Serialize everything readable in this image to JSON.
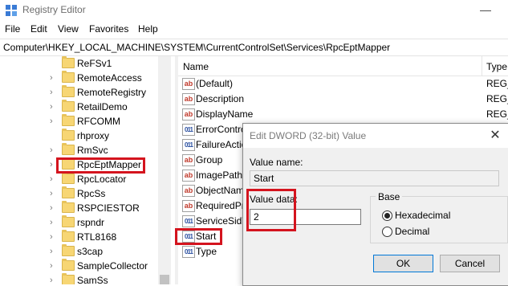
{
  "window": {
    "title": "Registry Editor",
    "minimize_glyph": "—"
  },
  "menu": [
    "File",
    "Edit",
    "View",
    "Favorites",
    "Help"
  ],
  "address": "Computer\\HKEY_LOCAL_MACHINE\\SYSTEM\\CurrentControlSet\\Services\\RpcEptMapper",
  "tree": {
    "items": [
      {
        "label": "ReFSv1",
        "has_children": false
      },
      {
        "label": "RemoteAccess",
        "has_children": true
      },
      {
        "label": "RemoteRegistry",
        "has_children": true
      },
      {
        "label": "RetailDemo",
        "has_children": true
      },
      {
        "label": "RFCOMM",
        "has_children": true
      },
      {
        "label": "rhproxy",
        "has_children": false
      },
      {
        "label": "RmSvc",
        "has_children": true
      },
      {
        "label": "RpcEptMapper",
        "has_children": true,
        "selected": true
      },
      {
        "label": "RpcLocator",
        "has_children": true
      },
      {
        "label": "RpcSs",
        "has_children": true
      },
      {
        "label": "RSPCIESTOR",
        "has_children": true
      },
      {
        "label": "rspndr",
        "has_children": true
      },
      {
        "label": "RTL8168",
        "has_children": true
      },
      {
        "label": "s3cap",
        "has_children": true
      },
      {
        "label": "SampleCollector",
        "has_children": true
      },
      {
        "label": "SamSs",
        "has_children": true
      }
    ]
  },
  "list": {
    "columns": {
      "name": "Name",
      "type": "Type"
    },
    "rows": [
      {
        "name": "(Default)",
        "type": "REG_",
        "kind": "string"
      },
      {
        "name": "Description",
        "type": "REG_",
        "kind": "string"
      },
      {
        "name": "DisplayName",
        "type": "REG_",
        "kind": "string"
      },
      {
        "name": "ErrorControl",
        "type": "",
        "kind": "dword"
      },
      {
        "name": "FailureActions",
        "type": "",
        "kind": "dword"
      },
      {
        "name": "Group",
        "type": "",
        "kind": "string"
      },
      {
        "name": "ImagePath",
        "type": "",
        "kind": "string"
      },
      {
        "name": "ObjectName",
        "type": "",
        "kind": "string"
      },
      {
        "name": "RequiredPrivileges",
        "type": "",
        "kind": "string"
      },
      {
        "name": "ServiceSidType",
        "type": "",
        "kind": "dword"
      },
      {
        "name": "Start",
        "type": "",
        "kind": "dword"
      },
      {
        "name": "Type",
        "type": "",
        "kind": "dword"
      }
    ]
  },
  "dialog": {
    "title": "Edit DWORD (32-bit) Value",
    "close_glyph": "✕",
    "value_name_label": "Value name:",
    "value_name": "Start",
    "value_data_label": "Value data:",
    "value_data": "2",
    "base_label": "Base",
    "base_options": [
      {
        "label": "Hexadecimal",
        "selected": true
      },
      {
        "label": "Decimal",
        "selected": false
      }
    ],
    "ok_label": "OK",
    "cancel_label": "Cancel"
  },
  "colors": {
    "highlight": "#d4141e",
    "folder": "#f7d674"
  }
}
